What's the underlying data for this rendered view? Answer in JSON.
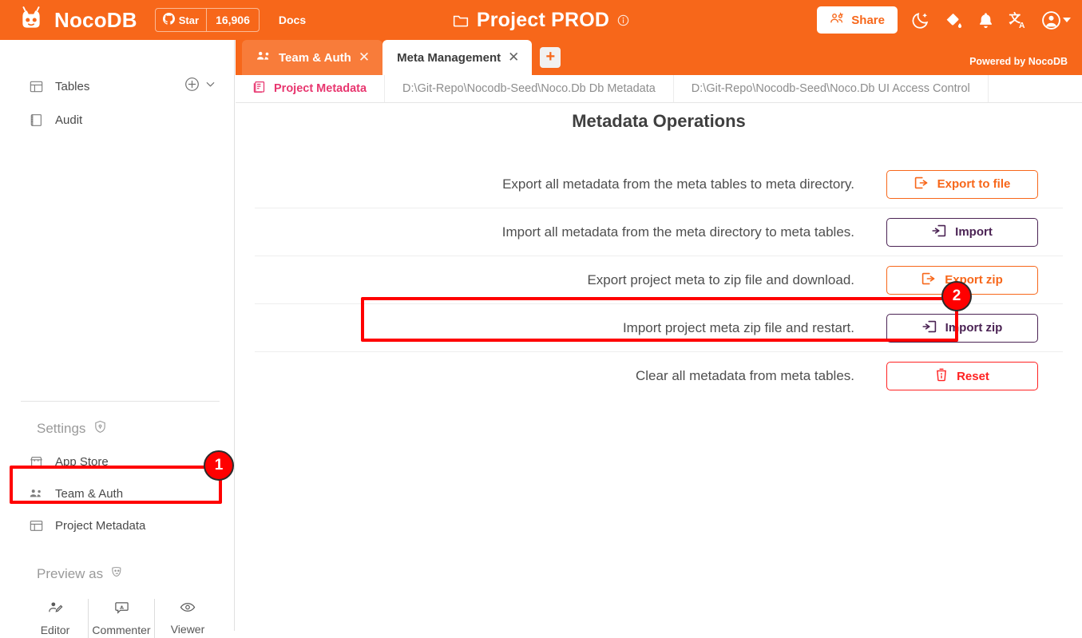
{
  "colors": {
    "brand_orange": "#F7671A",
    "accent_pink": "#E8366F",
    "purple": "#4b2354",
    "danger_red": "#FF2222",
    "annotation_red": "#FF0000"
  },
  "header": {
    "brand_name": "NocoDB",
    "logo_icon": "nocodb-logo-icon",
    "star_label": "Star",
    "star_icon": "github-icon",
    "star_count": "16,906",
    "docs_label": "Docs",
    "folder_icon": "folder-icon",
    "project_title": "Project PROD",
    "info_icon": "info-circle-icon",
    "share_label": "Share",
    "share_icon": "share-users-icon",
    "icons": [
      {
        "name": "moon-stars-icon"
      },
      {
        "name": "paint-bucket-icon"
      },
      {
        "name": "bell-icon"
      },
      {
        "name": "translate-icon"
      },
      {
        "name": "account-circle-icon"
      }
    ]
  },
  "tabs": {
    "items": [
      {
        "label": "Team & Auth",
        "icon": "team-icon",
        "active": false,
        "closable": true
      },
      {
        "label": "Meta Management",
        "icon": "",
        "active": true,
        "closable": true
      }
    ],
    "add_label": "+",
    "powered_by": "Powered by NocoDB"
  },
  "subtabs": {
    "items": [
      {
        "label": "Project Metadata",
        "icon": "metadata-icon",
        "active": true
      },
      {
        "label": "D:\\Git-Repo\\Nocodb-Seed\\Noco.Db Db Metadata",
        "icon": "",
        "active": false
      },
      {
        "label": "D:\\Git-Repo\\Nocodb-Seed\\Noco.Db UI Access Control",
        "icon": "",
        "active": false
      }
    ]
  },
  "sidebar": {
    "tables_label": "Tables",
    "tables_icon": "table-grid-icon",
    "add_table_icon": "plus-circle-icon",
    "tables_chevron_icon": "chevron-down-icon",
    "audit_label": "Audit",
    "audit_icon": "audit-book-icon",
    "settings_label": "Settings",
    "settings_icon": "shield-icon",
    "settings_items": [
      {
        "label": "App Store",
        "icon": "store-icon"
      },
      {
        "label": "Team & Auth",
        "icon": "team-icon"
      },
      {
        "label": "Project Metadata",
        "icon": "table-grid-icon"
      }
    ],
    "preview_label": "Preview as",
    "preview_icon": "masks-icon",
    "preview_roles": [
      {
        "label": "Editor",
        "icon": "user-edit-icon"
      },
      {
        "label": "Commenter",
        "icon": "comment-icon"
      },
      {
        "label": "Viewer",
        "icon": "eye-icon"
      }
    ]
  },
  "main": {
    "title": "Metadata Operations",
    "operations": [
      {
        "text": "Export all metadata from the meta tables to meta directory.",
        "button_label": "Export to file",
        "button_icon": "export-icon",
        "style": "orange"
      },
      {
        "text": "Import all metadata from the meta directory to meta tables.",
        "button_label": "Import",
        "button_icon": "import-icon",
        "style": "purple"
      },
      {
        "text": "Export project meta to zip file and download.",
        "button_label": "Export zip",
        "button_icon": "export-icon",
        "style": "orange"
      },
      {
        "text": "Import project meta zip file and restart.",
        "button_label": "Import zip",
        "button_icon": "import-icon",
        "style": "purple"
      },
      {
        "text": "Clear all metadata from meta tables.",
        "button_label": "Reset",
        "button_icon": "trash-icon",
        "style": "red"
      }
    ]
  },
  "annotations": [
    {
      "number": "1",
      "target": "sidebar-item-project-metadata"
    },
    {
      "number": "2",
      "target": "operation-row-import-zip"
    }
  ]
}
